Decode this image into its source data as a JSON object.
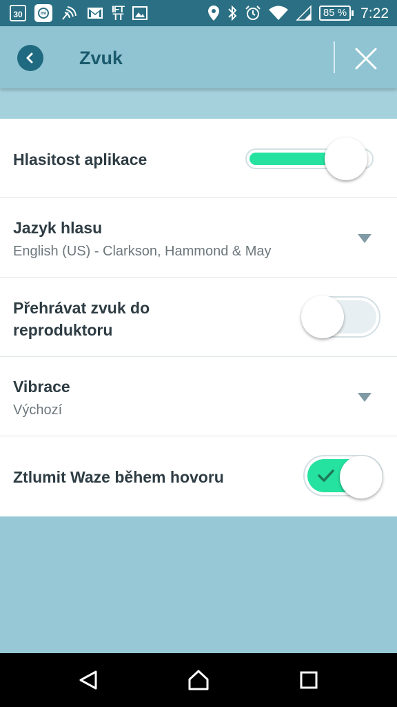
{
  "status_bar": {
    "calendar_day": "30",
    "mi_label": "mi",
    "ifttt_label": "IFT\nTT",
    "battery": "85 %",
    "time": "7:22",
    "icons": [
      "calendar-icon",
      "mi-fit-icon",
      "nfc-icon",
      "gmail-icon",
      "ifttt-icon",
      "gallery-icon",
      "location-icon",
      "bluetooth-icon",
      "alarm-icon",
      "wifi-icon",
      "signal-icon",
      "battery-icon"
    ]
  },
  "appbar": {
    "title": "Zvuk",
    "back_icon": "chevron-left-icon",
    "close_icon": "close-icon"
  },
  "settings": {
    "volume": {
      "label": "Hlasitost aplikace",
      "level": 0.8
    },
    "voice_language": {
      "label": "Jazyk hlasu",
      "value": "English (US) - Clarkson, Hammond & May"
    },
    "play_to_speaker": {
      "label_line1": "Přehrávat zvuk do",
      "label_line2": "reproduktoru",
      "on": false
    },
    "vibration": {
      "label": "Vibrace",
      "value": "Výchozí"
    },
    "mute_during_call": {
      "label": "Ztlumit Waze během hovoru",
      "on": true
    }
  },
  "navigation_bar": {
    "icons": [
      "back-triangle-icon",
      "home-icon",
      "recents-icon"
    ]
  },
  "colors": {
    "accent_green": "#25e2a0",
    "appbar_bg": "#91c4d2",
    "statusbar_bg": "#2a6f83",
    "title_color": "#1a5a6d",
    "background": "#97c8d6"
  }
}
